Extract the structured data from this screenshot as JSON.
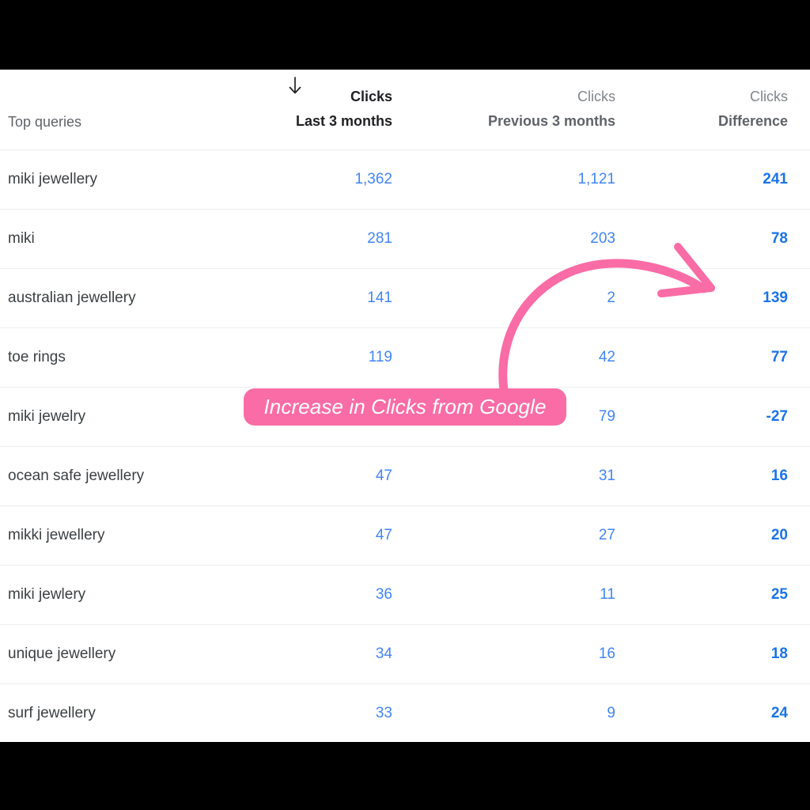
{
  "table": {
    "headers": {
      "query": "Top queries",
      "columns": [
        {
          "line1": "Clicks",
          "line2": "Last 3 months",
          "sorted": true,
          "sort_icon": "arrow-down-icon"
        },
        {
          "line1": "Clicks",
          "line2": "Previous 3 months",
          "sorted": false
        },
        {
          "line1": "Clicks",
          "line2": "Difference",
          "sorted": false
        }
      ]
    },
    "rows": [
      {
        "query": "miki jewellery",
        "last": "1,362",
        "previous": "1,121",
        "difference": "241"
      },
      {
        "query": "miki",
        "last": "281",
        "previous": "203",
        "difference": "78"
      },
      {
        "query": "australian jewellery",
        "last": "141",
        "previous": "2",
        "difference": "139"
      },
      {
        "query": "toe rings",
        "last": "119",
        "previous": "42",
        "difference": "77"
      },
      {
        "query": "miki jewelry",
        "last": "",
        "previous": "79",
        "difference": "-27"
      },
      {
        "query": "ocean safe jewellery",
        "last": "47",
        "previous": "31",
        "difference": "16"
      },
      {
        "query": "mikki jewellery",
        "last": "47",
        "previous": "27",
        "difference": "20"
      },
      {
        "query": "miki jewlery",
        "last": "36",
        "previous": "11",
        "difference": "25"
      },
      {
        "query": "unique jewellery",
        "last": "34",
        "previous": "16",
        "difference": "18"
      },
      {
        "query": "surf jewellery",
        "last": "33",
        "previous": "9",
        "difference": "24"
      }
    ]
  },
  "annotation": {
    "label": "Increase in Clicks from Google",
    "color": "#fa6ca6",
    "text_color": "#ffffff"
  },
  "colors": {
    "value_blue": "#4285f4",
    "difference_blue": "#1a73e8",
    "query_text": "#3c4043",
    "header_muted": "#5f6368",
    "row_divider": "#eceef0",
    "background": "#ffffff",
    "letterbox": "#000000"
  }
}
